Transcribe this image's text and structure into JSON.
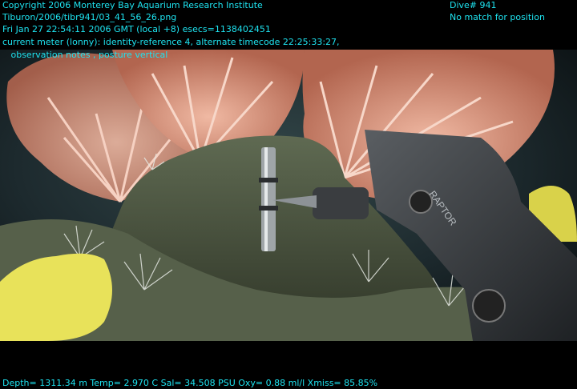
{
  "overlay": {
    "header_lines": [
      "Copyright 2006 Monterey Bay Aquarium Research Institute",
      "Tiburon/2006/tibr941/03_41_56_26.png",
      "Fri Jan 27 22:54:11 2006 GMT (local +8)  esecs=1138402451",
      "current meter (lonny): identity-reference 4, alternate timecode 22:25:33:27,",
      "   observation notes , posture vertical"
    ],
    "dive_label": "Dive# 941",
    "position_status": "No match for position",
    "footer": "Depth= 1311.34 m  Temp= 2.970 C  Sal= 34.508 PSU  Oxy= 0.88 ml/l  Xmiss= 85.85%"
  },
  "scene": {
    "manipulator_label": "RAPTOR",
    "colors": {
      "overlay_text": "#1ee3f0",
      "coral": "#d98a72",
      "rock": "#4d5540",
      "sponge": "#e8e25a",
      "water": "#1d2a2e"
    }
  }
}
